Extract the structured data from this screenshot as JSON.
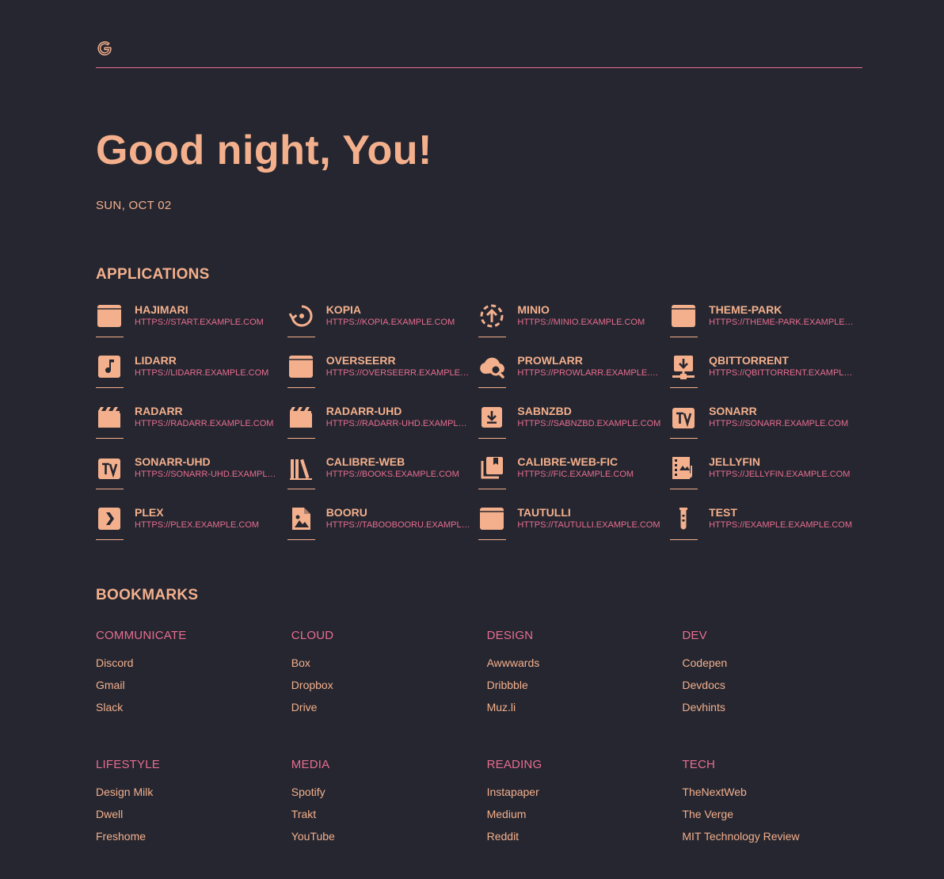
{
  "search": {
    "placeholder": ""
  },
  "greeting": "Good night, You!",
  "date": "SUN, OCT 02",
  "colors": {
    "background": "#252630",
    "accent": "#f4b08c",
    "secondary": "#e86d8f"
  },
  "applications": {
    "title": "APPLICATIONS",
    "items": [
      {
        "name": "HAJIMARI",
        "url": "HTTPS://START.EXAMPLE.COM",
        "icon": "window-icon"
      },
      {
        "name": "KOPIA",
        "url": "HTTPS://KOPIA.EXAMPLE.COM",
        "icon": "backup-restore-icon"
      },
      {
        "name": "MINIO",
        "url": "HTTPS://MINIO.EXAMPLE.COM",
        "icon": "upload-circle-icon"
      },
      {
        "name": "THEME-PARK",
        "url": "HTTPS://THEME-PARK.EXAMPLE.COM",
        "icon": "window-icon"
      },
      {
        "name": "LIDARR",
        "url": "HTTPS://LIDARR.EXAMPLE.COM",
        "icon": "music-note-icon"
      },
      {
        "name": "OVERSEERR",
        "url": "HTTPS://OVERSEERR.EXAMPLE.COM",
        "icon": "window-icon"
      },
      {
        "name": "PROWLARR",
        "url": "HTTPS://PROWLARR.EXAMPLE.COM",
        "icon": "cloud-search-icon"
      },
      {
        "name": "QBITTORRENT",
        "url": "HTTPS://QBITTORRENT.EXAMPLE.COM",
        "icon": "download-network-icon"
      },
      {
        "name": "RADARR",
        "url": "HTTPS://RADARR.EXAMPLE.COM",
        "icon": "movie-clapper-icon"
      },
      {
        "name": "RADARR-UHD",
        "url": "HTTPS://RADARR-UHD.EXAMPLE.COM",
        "icon": "movie-clapper-icon"
      },
      {
        "name": "SABNZBD",
        "url": "HTTPS://SABNZBD.EXAMPLE.COM",
        "icon": "download-box-icon"
      },
      {
        "name": "SONARR",
        "url": "HTTPS://SONARR.EXAMPLE.COM",
        "icon": "tv-icon"
      },
      {
        "name": "SONARR-UHD",
        "url": "HTTPS://SONARR-UHD.EXAMPLE.COM",
        "icon": "tv-icon"
      },
      {
        "name": "CALIBRE-WEB",
        "url": "HTTPS://BOOKS.EXAMPLE.COM",
        "icon": "library-shelves-icon"
      },
      {
        "name": "CALIBRE-WEB-FIC",
        "url": "HTTPS://FIC.EXAMPLE.COM",
        "icon": "books-stack-icon"
      },
      {
        "name": "JELLYFIN",
        "url": "HTTPS://JELLYFIN.EXAMPLE.COM",
        "icon": "filmstrip-music-icon"
      },
      {
        "name": "PLEX",
        "url": "HTTPS://PLEX.EXAMPLE.COM",
        "icon": "plex-chevron-icon"
      },
      {
        "name": "BOORU",
        "url": "HTTPS://TABOOBOORU.EXAMPLE.COM",
        "icon": "file-image-icon"
      },
      {
        "name": "TAUTULLI",
        "url": "HTTPS://TAUTULLI.EXAMPLE.COM",
        "icon": "window-icon"
      },
      {
        "name": "TEST",
        "url": "HTTPS://EXAMPLE.EXAMPLE.COM",
        "icon": "test-tube-icon"
      }
    ]
  },
  "bookmarks": {
    "title": "BOOKMARKS",
    "groups": [
      {
        "category": "COMMUNICATE",
        "links": [
          "Discord",
          "Gmail",
          "Slack"
        ]
      },
      {
        "category": "CLOUD",
        "links": [
          "Box",
          "Dropbox",
          "Drive"
        ]
      },
      {
        "category": "DESIGN",
        "links": [
          "Awwwards",
          "Dribbble",
          "Muz.li"
        ]
      },
      {
        "category": "DEV",
        "links": [
          "Codepen",
          "Devdocs",
          "Devhints"
        ]
      },
      {
        "category": "LIFESTYLE",
        "links": [
          "Design Milk",
          "Dwell",
          "Freshome"
        ]
      },
      {
        "category": "MEDIA",
        "links": [
          "Spotify",
          "Trakt",
          "YouTube"
        ]
      },
      {
        "category": "READING",
        "links": [
          "Instapaper",
          "Medium",
          "Reddit"
        ]
      },
      {
        "category": "TECH",
        "links": [
          "TheNextWeb",
          "The Verge",
          "MIT Technology Review"
        ]
      }
    ]
  }
}
